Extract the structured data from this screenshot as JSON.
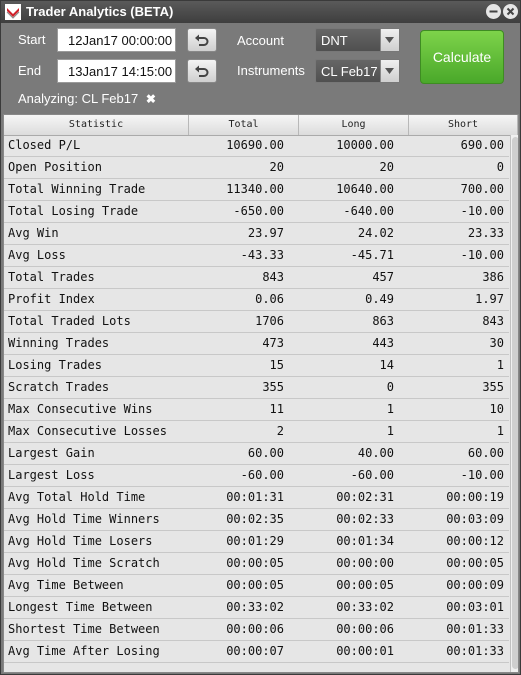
{
  "window": {
    "title": "Trader Analytics (BETA)"
  },
  "controls": {
    "start_label": "Start",
    "start_value": "12Jan17 00:00:00",
    "end_label": "End",
    "end_value": "13Jan17 14:15:00",
    "account_label": "Account",
    "account_value": "DNT",
    "instruments_label": "Instruments",
    "instruments_value": "CL Feb17",
    "calculate_label": "Calculate",
    "analyzing_label": "Analyzing:",
    "analyzing_value": "CL Feb17"
  },
  "table": {
    "columns": [
      "Statistic",
      "Total",
      "Long",
      "Short"
    ],
    "rows": [
      [
        "Closed P/L",
        "10690.00",
        "10000.00",
        "690.00"
      ],
      [
        "Open Position",
        "20",
        "20",
        "0"
      ],
      [
        "Total Winning Trade",
        "11340.00",
        "10640.00",
        "700.00"
      ],
      [
        "Total Losing Trade",
        "-650.00",
        "-640.00",
        "-10.00"
      ],
      [
        "Avg Win",
        "23.97",
        "24.02",
        "23.33"
      ],
      [
        "Avg Loss",
        "-43.33",
        "-45.71",
        "-10.00"
      ],
      [
        "Total Trades",
        "843",
        "457",
        "386"
      ],
      [
        "Profit Index",
        "0.06",
        "0.49",
        "1.97"
      ],
      [
        "Total Traded Lots",
        "1706",
        "863",
        "843"
      ],
      [
        "Winning Trades",
        "473",
        "443",
        "30"
      ],
      [
        "Losing Trades",
        "15",
        "14",
        "1"
      ],
      [
        "Scratch Trades",
        "355",
        "0",
        "355"
      ],
      [
        "Max Consecutive Wins",
        "11",
        "1",
        "10"
      ],
      [
        "Max Consecutive Losses",
        "2",
        "1",
        "1"
      ],
      [
        "Largest Gain",
        "60.00",
        "40.00",
        "60.00"
      ],
      [
        "Largest Loss",
        "-60.00",
        "-60.00",
        "-10.00"
      ],
      [
        "Avg Total Hold Time",
        "00:01:31",
        "00:02:31",
        "00:00:19"
      ],
      [
        "Avg Hold Time Winners",
        "00:02:35",
        "00:02:33",
        "00:03:09"
      ],
      [
        "Avg Hold Time Losers",
        "00:01:29",
        "00:01:34",
        "00:00:12"
      ],
      [
        "Avg Hold Time Scratch",
        "00:00:05",
        "00:00:00",
        "00:00:05"
      ],
      [
        "Avg Time Between",
        "00:00:05",
        "00:00:05",
        "00:00:09"
      ],
      [
        "Longest Time Between",
        "00:33:02",
        "00:33:02",
        "00:03:01"
      ],
      [
        "Shortest Time Between",
        "00:00:06",
        "00:00:06",
        "00:01:33"
      ],
      [
        "Avg Time After Losing",
        "00:00:07",
        "00:00:01",
        "00:01:33"
      ]
    ]
  },
  "colors": {
    "panel_bg": "#7a7a7a",
    "calculate_green": "#5cba36",
    "grid_bg": "#e6e6e6"
  }
}
